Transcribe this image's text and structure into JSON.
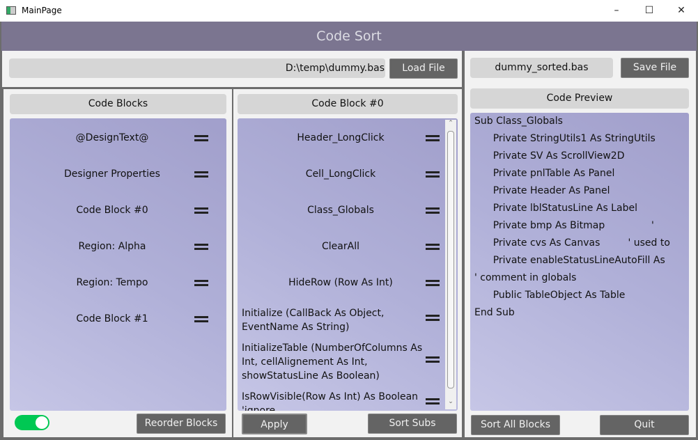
{
  "window": {
    "title": "MainPage",
    "controls": [
      "minimize",
      "maximize",
      "close"
    ]
  },
  "header": {
    "title": "Code Sort"
  },
  "left": {
    "file_path": "D:\\temp\\dummy.bas",
    "load_label": "Load File",
    "blocks_header": "Code Blocks",
    "blocks": [
      "@DesignText@",
      "Designer Properties",
      "Code Block #0",
      "Region: Alpha",
      "Region:  Tempo",
      "Code Block #1"
    ],
    "toggle_on": true,
    "reorder_label": "Reorder Blocks",
    "block_header": "Code Block #0",
    "subs": [
      "Header_LongClick",
      "Cell_LongClick",
      "Class_Globals",
      "ClearAll",
      "HideRow (Row As Int)",
      "Initialize (CallBack As Object, EventName As String)",
      "InitializeTable (NumberOfColumns As Int, cellAlignement As Int, showStatusLine As Boolean)",
      "IsRowVisible(Row As Int) As Boolean          'ignore"
    ],
    "apply_label": "Apply",
    "sort_subs_label": "Sort Subs"
  },
  "right": {
    "output_file": "dummy_sorted.bas",
    "save_label": "Save File",
    "preview_header": "Code Preview",
    "preview_lines": [
      "Sub Class_Globals",
      "\tPrivate StringUtils1 As StringUtils",
      "\tPrivate SV As ScrollView2D",
      "\tPrivate pnlTable As Panel",
      "\tPrivate Header As Panel",
      "\tPrivate lblStatusLine As Label",
      "\tPrivate bmp As Bitmap               '",
      "\tPrivate cvs As Canvas         ' used to",
      "\tPrivate enableStatusLineAutoFill As",
      "' comment in globals",
      "\tPublic TableObject As Table",
      "End Sub"
    ],
    "sort_all_label": "Sort All Blocks",
    "quit_label": "Quit"
  },
  "colors": {
    "header": "#7b7590",
    "button": "#646464",
    "toggle": "#00c853"
  }
}
